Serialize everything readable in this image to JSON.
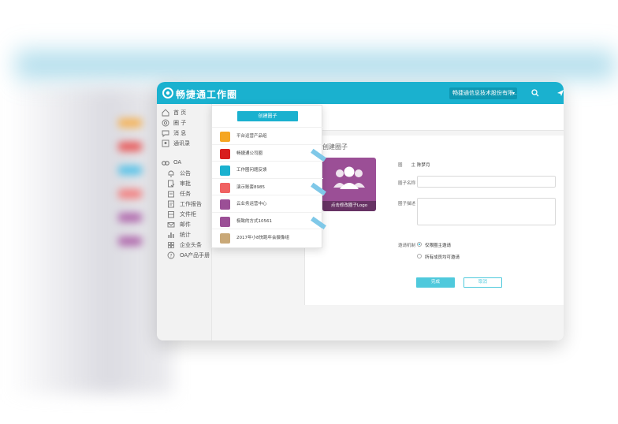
{
  "colors": {
    "accent": "#1ab1cf",
    "logo_bg": "#9b4f96",
    "button": "#4fc9dc"
  },
  "app": {
    "title": "畅捷通工作圈",
    "org_select": "畅捷通信息技术股份有限..."
  },
  "sidebar": {
    "items": [
      {
        "label": "首 页",
        "icon": "home-icon"
      },
      {
        "label": "圈 子",
        "icon": "circle-icon"
      },
      {
        "label": "消 息",
        "icon": "message-icon"
      },
      {
        "label": "通讯录",
        "icon": "contacts-icon"
      }
    ],
    "oa": {
      "label": "OA",
      "icon": "oa-icon"
    },
    "oa_items": [
      {
        "label": "公告",
        "icon": "bell-icon"
      },
      {
        "label": "审批",
        "icon": "approval-icon"
      },
      {
        "label": "任务",
        "icon": "task-icon"
      },
      {
        "label": "工作报告",
        "icon": "report-icon"
      },
      {
        "label": "文件柜",
        "icon": "cabinet-icon"
      },
      {
        "label": "邮件",
        "icon": "mail-icon"
      },
      {
        "label": "统计",
        "icon": "chart-icon"
      },
      {
        "label": "企业头条",
        "icon": "news-icon"
      },
      {
        "label": "OA产品手册",
        "icon": "help-icon"
      }
    ]
  },
  "dropdown": {
    "create_button": "创建圈子",
    "items": [
      {
        "label": "平台运营产品组",
        "color": "#f5a623",
        "ribbon": false
      },
      {
        "label": "畅捷通公司圈",
        "color": "#d81e1e",
        "ribbon": true
      },
      {
        "label": "工作圈问题反馈",
        "color": "#1ab1cf",
        "ribbon": false
      },
      {
        "label": "演示账套8985",
        "color": "#f06262",
        "ribbon": true
      },
      {
        "label": "云业务运营中心",
        "color": "#9b4f96",
        "ribbon": false
      },
      {
        "label": "极致的方式10561",
        "color": "#9b4f96",
        "ribbon": true
      },
      {
        "label": "2017年小8快跑年会摄像组",
        "color": "#c9a877",
        "ribbon": false
      }
    ]
  },
  "form": {
    "title": "创建圈子",
    "logo_caption": "点击修改圈子Logo",
    "owner_label": "圈　　主",
    "owner_value": "陈梦月",
    "name_label": "圈子名称",
    "desc_label": "圈子描述",
    "invite_label": "邀请机制",
    "invite_options": [
      "仅限圈主邀请",
      "所有成员均可邀请"
    ],
    "submit": "完成",
    "cancel": "取消"
  }
}
